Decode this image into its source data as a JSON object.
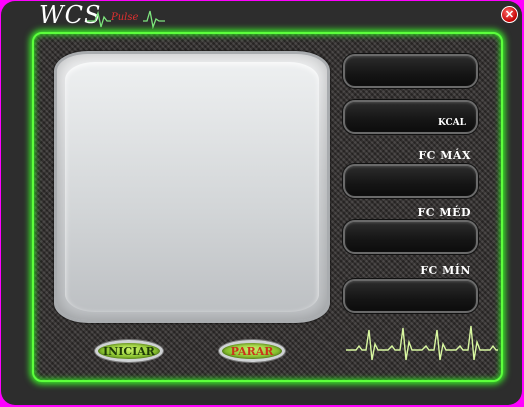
{
  "app": {
    "title": "WCS",
    "subtitle": "Pulse",
    "close_glyph": "✕"
  },
  "stats": {
    "kcal_label": "KCAL",
    "fc_max_label": "FC MÁX",
    "fc_med_label": "FC MÉD",
    "fc_min_label": "FC MÍN"
  },
  "controls": {
    "start_label": "INICIAR",
    "stop_label": "PARAR"
  },
  "colors": {
    "frame_glow": "#5cff3c",
    "ecg_line": "#d8f7a0",
    "title_wave": "#7ee67e",
    "pulse_text": "#e03030"
  },
  "icons": {
    "close": "close-icon",
    "ecg": "heartbeat-icon"
  }
}
